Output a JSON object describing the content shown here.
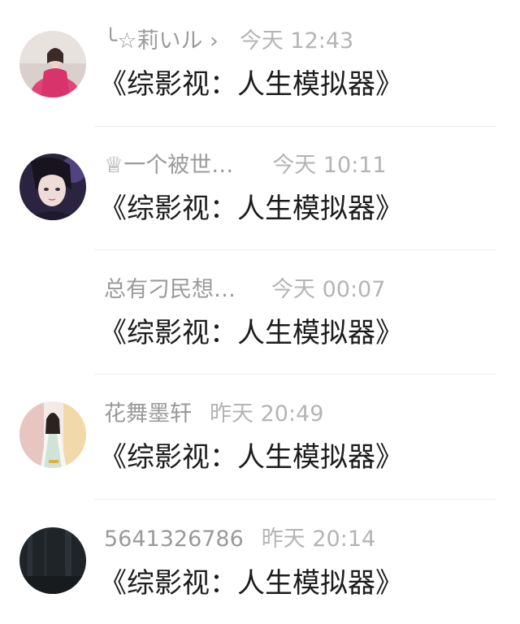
{
  "messages": [
    {
      "name": "╰☆莉いル ›",
      "time": "今天 12:43",
      "text": "《综影视：人生模拟器》",
      "avatar": "girl-pink-dress-avatar"
    },
    {
      "name": "♕一个被世…",
      "time": "今天 10:11",
      "text": "《综影视：人生模拟器》",
      "avatar": "anime-boy-avatar"
    },
    {
      "name": "总有刁民想…",
      "time": "今天 00:07",
      "text": "《综影视：人生模拟器》",
      "avatar": ""
    },
    {
      "name": "花舞墨轩",
      "time": "昨天 20:49",
      "text": "《综影视：人生模拟器》",
      "avatar": "hanfu-figure-avatar"
    },
    {
      "name": "5641326786",
      "time": "昨天 20:14",
      "text": "《综影视：人生模拟器》",
      "avatar": "dark-avatar"
    }
  ]
}
